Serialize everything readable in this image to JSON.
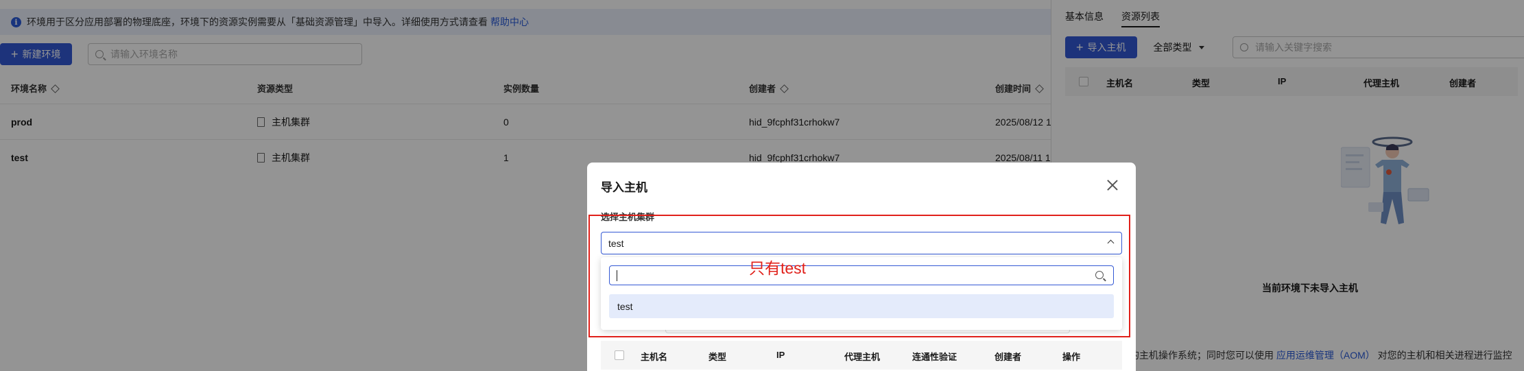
{
  "notice": {
    "text": "环境用于区分应用部署的物理底座，环境下的资源实例需要从「基础资源管理」中导入。详细使用方式请查看",
    "link": "帮助中心"
  },
  "toolbar": {
    "new_env_label": "新建环境",
    "search_placeholder": "请输入环境名称"
  },
  "env_table": {
    "headers": [
      "环境名称",
      "资源类型",
      "实例数量",
      "创建者",
      "创建时间"
    ],
    "rows": [
      {
        "name": "prod",
        "type": "主机集群",
        "count": "0",
        "creator": "hid_9fcphf31crhokw7",
        "created": "2025/08/12 1"
      },
      {
        "name": "test",
        "type": "主机集群",
        "count": "1",
        "creator": "hid_9fcphf31crhokw7",
        "created": "2025/08/11 1"
      }
    ]
  },
  "drawer": {
    "tabs": [
      "基本信息",
      "资源列表"
    ],
    "import_label": "导入主机",
    "type_select": "全部类型",
    "search_placeholder": "请输入关键字搜索",
    "headers": [
      "主机名",
      "类型",
      "IP",
      "代理主机",
      "创建者"
    ],
    "empty_text": "当前环境下未导入主机",
    "footer_prefix": "持的主机操作系统；同时您可以使用",
    "footer_link": "应用运维管理（AOM）",
    "footer_suffix": "对您的主机和相关进程进行监控"
  },
  "modal": {
    "title": "导入主机",
    "field_label": "选择主机集群",
    "selected_value": "test",
    "dropdown_search_value": "",
    "options": [
      "test"
    ],
    "table_headers": [
      "主机名",
      "类型",
      "IP",
      "代理主机",
      "连通性验证",
      "创建者",
      "操作"
    ]
  },
  "annotation": {
    "text": "只有test",
    "color": "#e0201a"
  }
}
